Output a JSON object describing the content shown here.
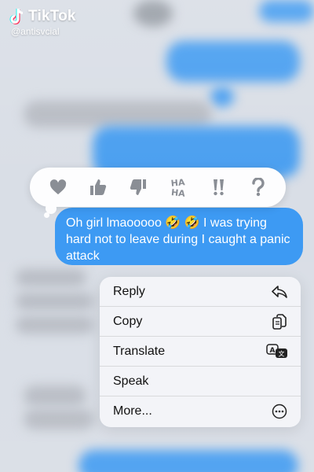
{
  "watermark": {
    "brand": "TikTok",
    "handle": "@antisvcial"
  },
  "tapbacks": [
    "heart-icon",
    "thumbs-up-icon",
    "thumbs-down-icon",
    "haha-icon",
    "exclamation-icon",
    "question-icon"
  ],
  "tapback_labels": {
    "haha": "HA HA",
    "emphasize": "!!",
    "question": "?"
  },
  "message": {
    "text": "Oh girl lmaooooo 🤣 🤣 I was trying hard not to leave during I caught a panic attack"
  },
  "menu": {
    "items": [
      {
        "label": "Reply",
        "icon": "reply-icon"
      },
      {
        "label": "Copy",
        "icon": "copy-icon"
      },
      {
        "label": "Translate",
        "icon": "translate-icon"
      },
      {
        "label": "Speak",
        "icon": ""
      },
      {
        "label": "More...",
        "icon": "more-icon"
      }
    ]
  },
  "colors": {
    "bubble": "#3d9af3",
    "menu_bg": "#f4f5f8",
    "tapback_icon": "#8a8e95"
  }
}
